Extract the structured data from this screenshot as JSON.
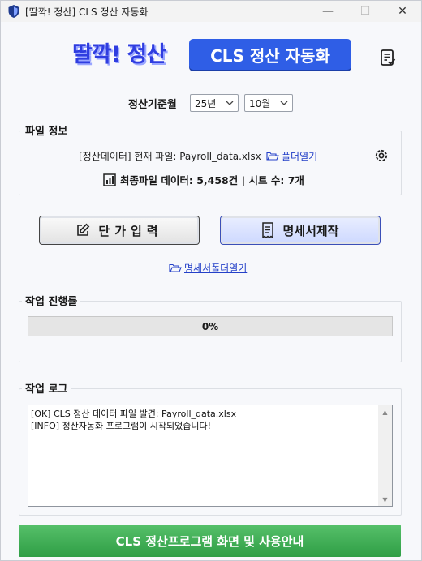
{
  "window": {
    "title": "[딸깍! 정산] CLS 정산 자동화",
    "minimize_glyph": "—",
    "maximize_glyph": "☐",
    "close_glyph": "✕"
  },
  "header": {
    "logo_text": "딸깍! 정산",
    "badge_text": "CLS 정산 자동화",
    "doc_icon": "document-check-icon"
  },
  "period": {
    "label": "정산기준월",
    "year_value": "25년",
    "month_value": "10월"
  },
  "file_info": {
    "title": "파일 정보",
    "current_file_text": "[정산데이터] 현재 파일: Payroll_data.xlsx",
    "folder_link": "폴더열기",
    "stats_text": "최종파일 데이터: 5,458건 | 시트 수: 7개",
    "settings_icon": "gear-icon"
  },
  "actions": {
    "price_input_label": "단가입력",
    "statement_label": "명세서제작",
    "statement_folder_link": "명세서폴더열기"
  },
  "progress": {
    "title": "작업 진행률",
    "value": 0,
    "text": "0%"
  },
  "log": {
    "title": "작업 로그",
    "lines": [
      "[OK] CLS 정산 데이터 파일 발견: Payroll_data.xlsx",
      "[INFO] 정산자동화 프로그램이 시작되었습니다!"
    ]
  },
  "footer": {
    "guide_button": "CLS 정산프로그램 화면 및 사용안내"
  },
  "colors": {
    "accent_blue": "#2f5ee6",
    "link_blue": "#2440c8",
    "guide_green": "#3fae55"
  }
}
